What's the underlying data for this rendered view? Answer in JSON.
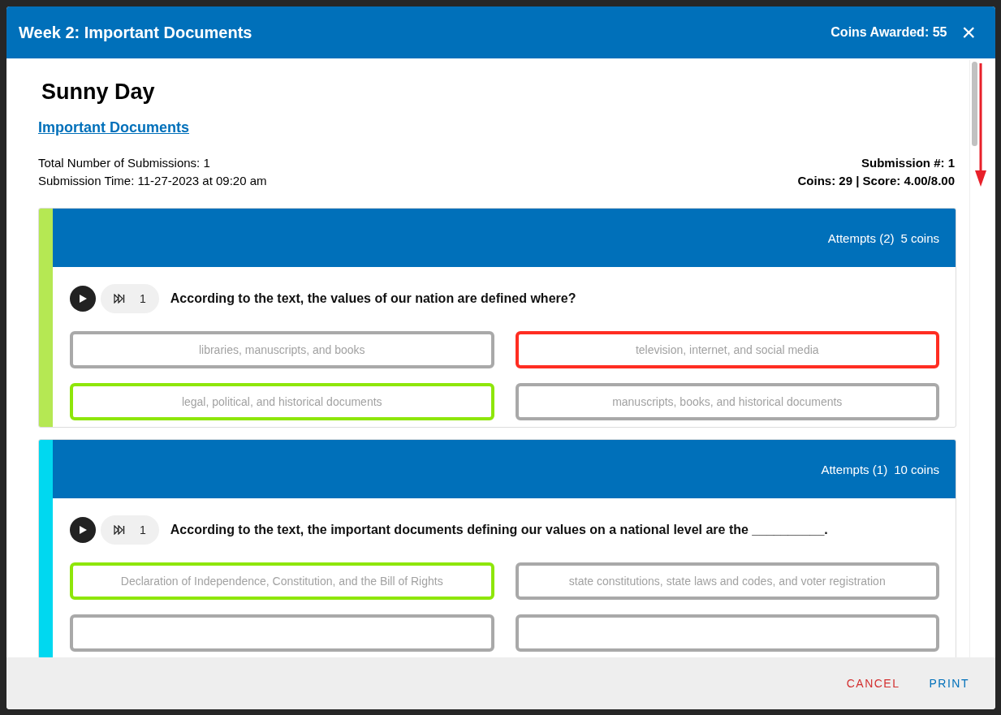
{
  "dialog": {
    "title": "Week 2: Important Documents",
    "coins_awarded": "Coins Awarded: 55",
    "close": "×"
  },
  "student": "Sunny Day",
  "assignment_link": "Important Documents",
  "summary": {
    "total_submissions": "Total Number of Submissions: 1",
    "submission_time": "Submission Time: 11-27-2023 at 09:20 am",
    "submission_number": "Submission #: 1",
    "coins_score": "Coins: 29 | Score: 4.00/8.00"
  },
  "questions": [
    {
      "color": "#b5e853",
      "attempts": "Attempts (2)",
      "coins": "5 coins",
      "speed": "1",
      "text": "According to the text, the values of our nation are defined where?",
      "options": [
        {
          "label": "libraries, manuscripts, and books",
          "correct": false,
          "wrong": false
        },
        {
          "label": "television, internet, and social media",
          "correct": false,
          "wrong": true
        },
        {
          "label": "legal, political, and historical documents",
          "correct": true,
          "wrong": false
        },
        {
          "label": "manuscripts, books, and historical documents",
          "correct": false,
          "wrong": false
        }
      ]
    },
    {
      "color": "#00d8f0",
      "attempts": "Attempts (1)",
      "coins": "10 coins",
      "speed": "1",
      "text": "According to the text, the important documents defining our values on a national level are the __________.",
      "options": [
        {
          "label": "Declaration of Independence, Constitution, and the Bill of Rights",
          "correct": true,
          "wrong": false
        },
        {
          "label": "state constitutions, state laws and codes, and voter registration",
          "correct": false,
          "wrong": false
        },
        {
          "correct": false,
          "wrong": false
        },
        {
          "correct": false,
          "wrong": false
        }
      ]
    }
  ],
  "footer": {
    "buttons": [
      {
        "label": "CANCEL",
        "kind": "cancel"
      },
      {
        "label": "PRINT",
        "kind": "print"
      }
    ]
  }
}
